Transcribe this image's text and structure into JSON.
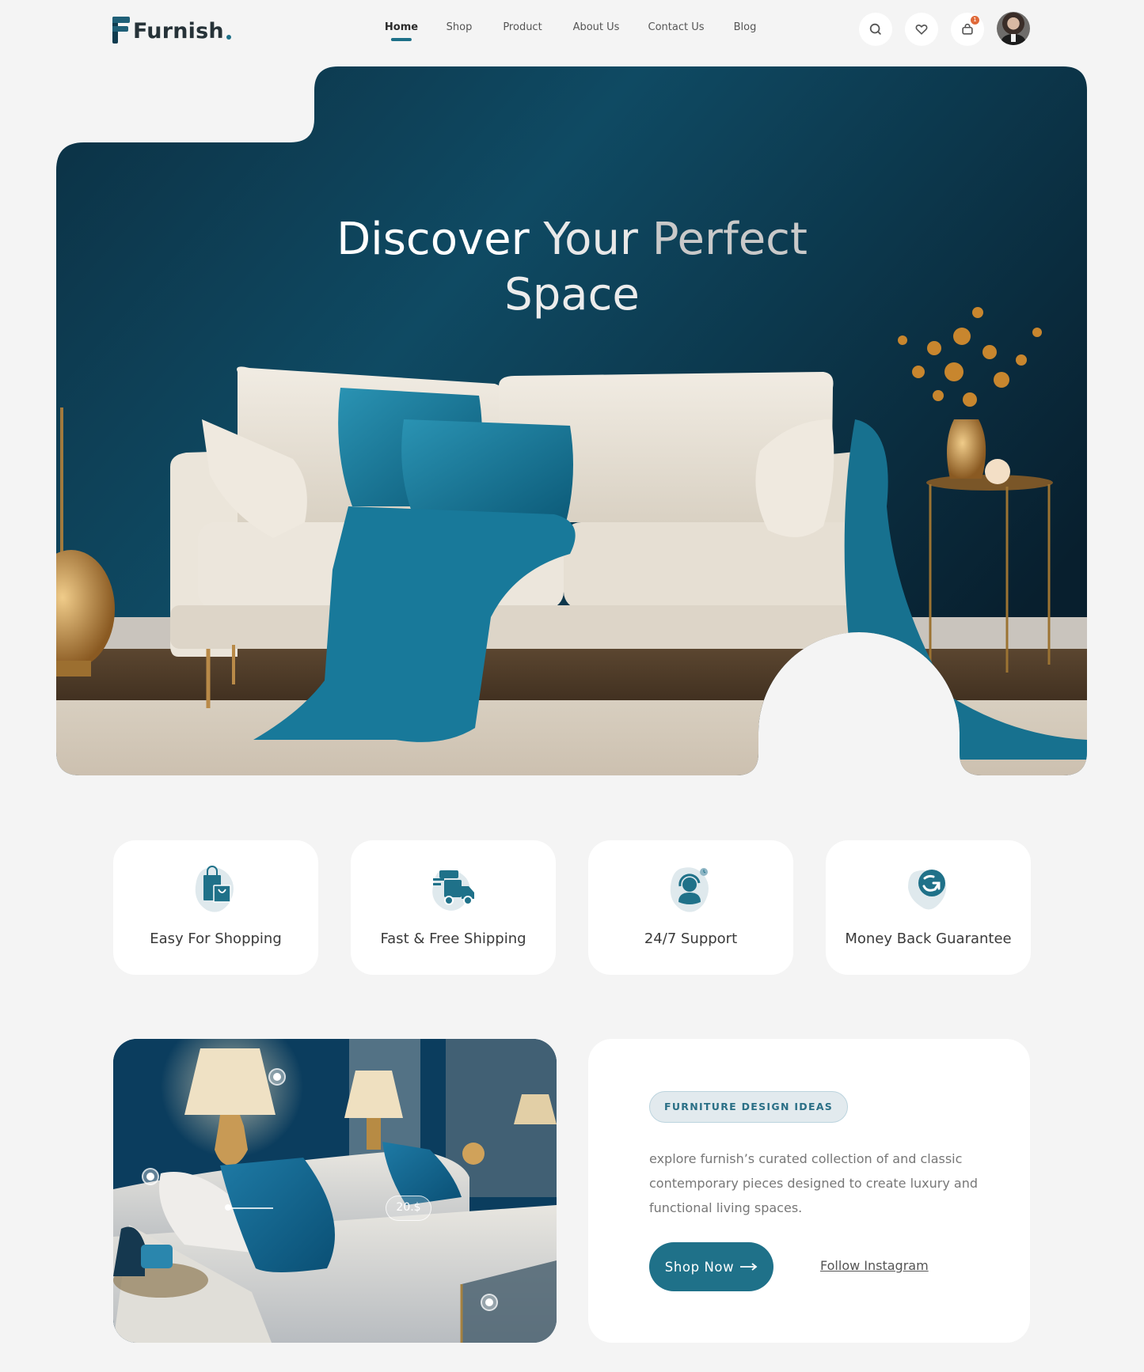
{
  "brand": {
    "name": "Furnish",
    "accent": "#1e7088",
    "dark": "#0f3b4f"
  },
  "nav": {
    "items": [
      {
        "label": "Home",
        "active": true
      },
      {
        "label": "Shop",
        "active": false
      },
      {
        "label": "Product",
        "active": false
      },
      {
        "label": "About Us",
        "active": false
      },
      {
        "label": "Contact Us",
        "active": false
      },
      {
        "label": "Blog",
        "active": false
      }
    ],
    "icons": [
      "search-icon",
      "heart-icon",
      "shopping-bag-icon",
      "avatar"
    ],
    "cart_count": "1"
  },
  "hero": {
    "title_words": [
      "Discover",
      "Your",
      "Perfect",
      "Space"
    ]
  },
  "features": [
    {
      "label": "Easy For Shopping",
      "icon": "shopping-bags-icon"
    },
    {
      "label": "Fast & Free Shipping",
      "icon": "delivery-truck-icon"
    },
    {
      "label": "24/7 Support",
      "icon": "support-agent-icon"
    },
    {
      "label": "Money Back Guarantee",
      "icon": "money-back-icon"
    }
  ],
  "showcase": {
    "price_tag": "20.$",
    "tag": "FURNITURE DESIGN IDEAS",
    "description": "explore furnish’s curated collection of and classic contemporary pieces designed to create luxury and functional living spaces.",
    "primary_button": "Shop Now",
    "secondary_link": "Follow Instagram"
  }
}
